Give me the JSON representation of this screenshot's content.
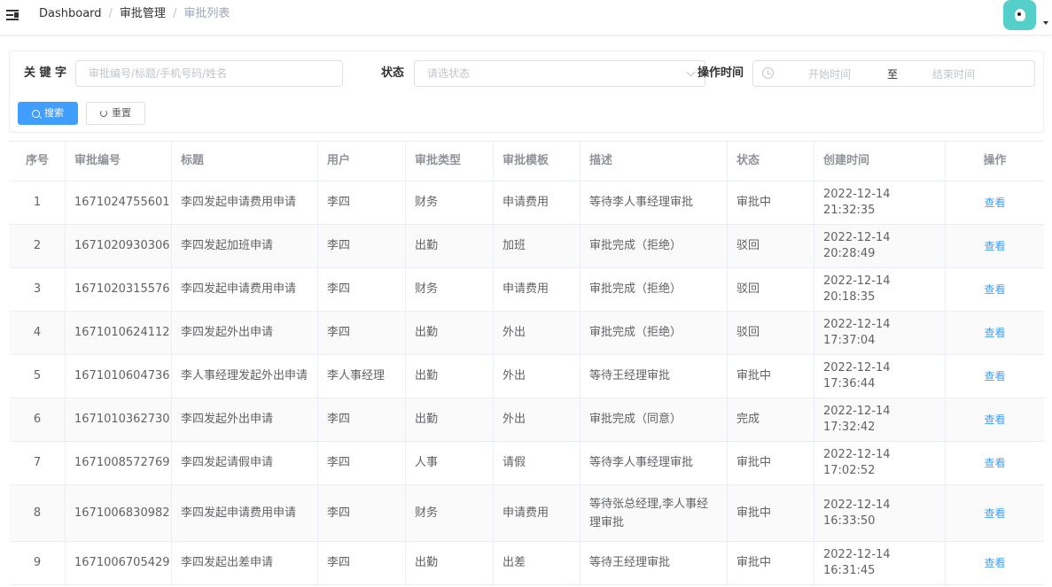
{
  "header": {
    "breadcrumb": [
      "Dashboard",
      "审批管理",
      "审批列表"
    ],
    "breadcrumb_sep": "/"
  },
  "filters": {
    "keyword_label": "关 键 字",
    "keyword_placeholder": "审批编号/标题/手机号码/姓名",
    "status_label": "状态",
    "status_placeholder": "请选状态",
    "time_label": "操作时间",
    "start_placeholder": "开始时间",
    "range_sep": "至",
    "end_placeholder": "结束时间",
    "search_btn": "搜索",
    "reset_btn": "重置"
  },
  "table": {
    "columns": [
      "序号",
      "审批编号",
      "标题",
      "用户",
      "审批类型",
      "审批模板",
      "描述",
      "状态",
      "创建时间",
      "操作"
    ],
    "action_label": "查看",
    "rows": [
      [
        "1",
        "1671024755601",
        "李四发起申请费用申请",
        "李四",
        "财务",
        "申请费用",
        "等待李人事经理审批",
        "审批中",
        "2022-12-14 21:32:35"
      ],
      [
        "2",
        "1671020930306",
        "李四发起加班申请",
        "李四",
        "出勤",
        "加班",
        "审批完成（拒绝）",
        "驳回",
        "2022-12-14 20:28:49"
      ],
      [
        "3",
        "1671020315576",
        "李四发起申请费用申请",
        "李四",
        "财务",
        "申请费用",
        "审批完成（拒绝）",
        "驳回",
        "2022-12-14 20:18:35"
      ],
      [
        "4",
        "1671010624112",
        "李四发起外出申请",
        "李四",
        "出勤",
        "外出",
        "审批完成（拒绝）",
        "驳回",
        "2022-12-14 17:37:04"
      ],
      [
        "5",
        "1671010604736",
        "李人事经理发起外出申请",
        "李人事经理",
        "出勤",
        "外出",
        "等待王经理审批",
        "审批中",
        "2022-12-14 17:36:44"
      ],
      [
        "6",
        "1671010362730",
        "李四发起外出申请",
        "李四",
        "出勤",
        "外出",
        "审批完成（同意）",
        "完成",
        "2022-12-14 17:32:42"
      ],
      [
        "7",
        "1671008572769",
        "李四发起请假申请",
        "李四",
        "人事",
        "请假",
        "等待李人事经理审批",
        "审批中",
        "2022-12-14 17:02:52"
      ],
      [
        "8",
        "1671006830982",
        "李四发起申请费用申请",
        "李四",
        "财务",
        "申请费用",
        "等待张总经理,李人事经理审批",
        "审批中",
        "2022-12-14 16:33:50"
      ],
      [
        "9",
        "1671006705429",
        "李四发起出差申请",
        "李四",
        "出勤",
        "出差",
        "等待王经理审批",
        "审批中",
        "2022-12-14 16:31:45"
      ]
    ]
  }
}
